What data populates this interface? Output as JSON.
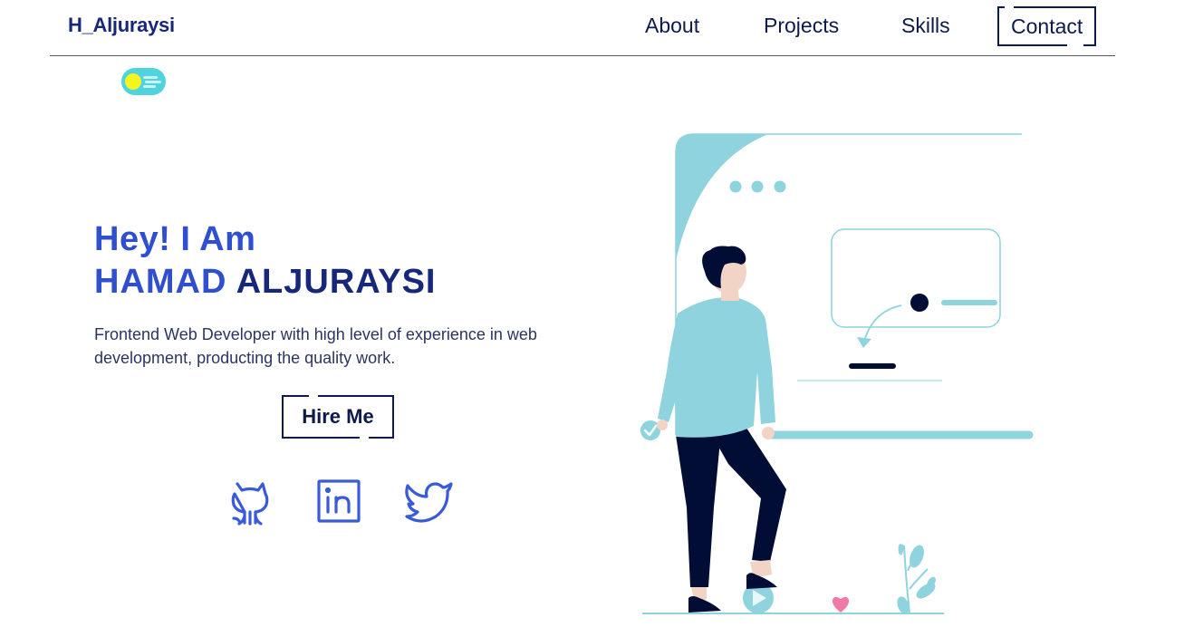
{
  "header": {
    "logo": "H_Aljuraysi",
    "nav": [
      {
        "label": "About"
      },
      {
        "label": "Projects"
      },
      {
        "label": "Skills"
      },
      {
        "label": "Contact"
      }
    ]
  },
  "theme_toggle": {
    "icon": "sun-icon",
    "colors": {
      "track": "#4fd3dc",
      "knob": "#f5f51e"
    }
  },
  "hero": {
    "greeting": "Hey! I Am",
    "name_first": "HAMAD",
    "name_last": "ALJURAYSI",
    "description": "Frontend Web Developer with high level of experience in web development, producting the quality work.",
    "cta_label": "Hire Me"
  },
  "social": [
    {
      "icon": "github-icon"
    },
    {
      "icon": "linkedin-icon"
    },
    {
      "icon": "twitter-icon"
    }
  ],
  "colors": {
    "primary": "#2f4fcf",
    "navy": "#17287a",
    "accent": "#8ed3dd",
    "dark": "#020d35"
  }
}
